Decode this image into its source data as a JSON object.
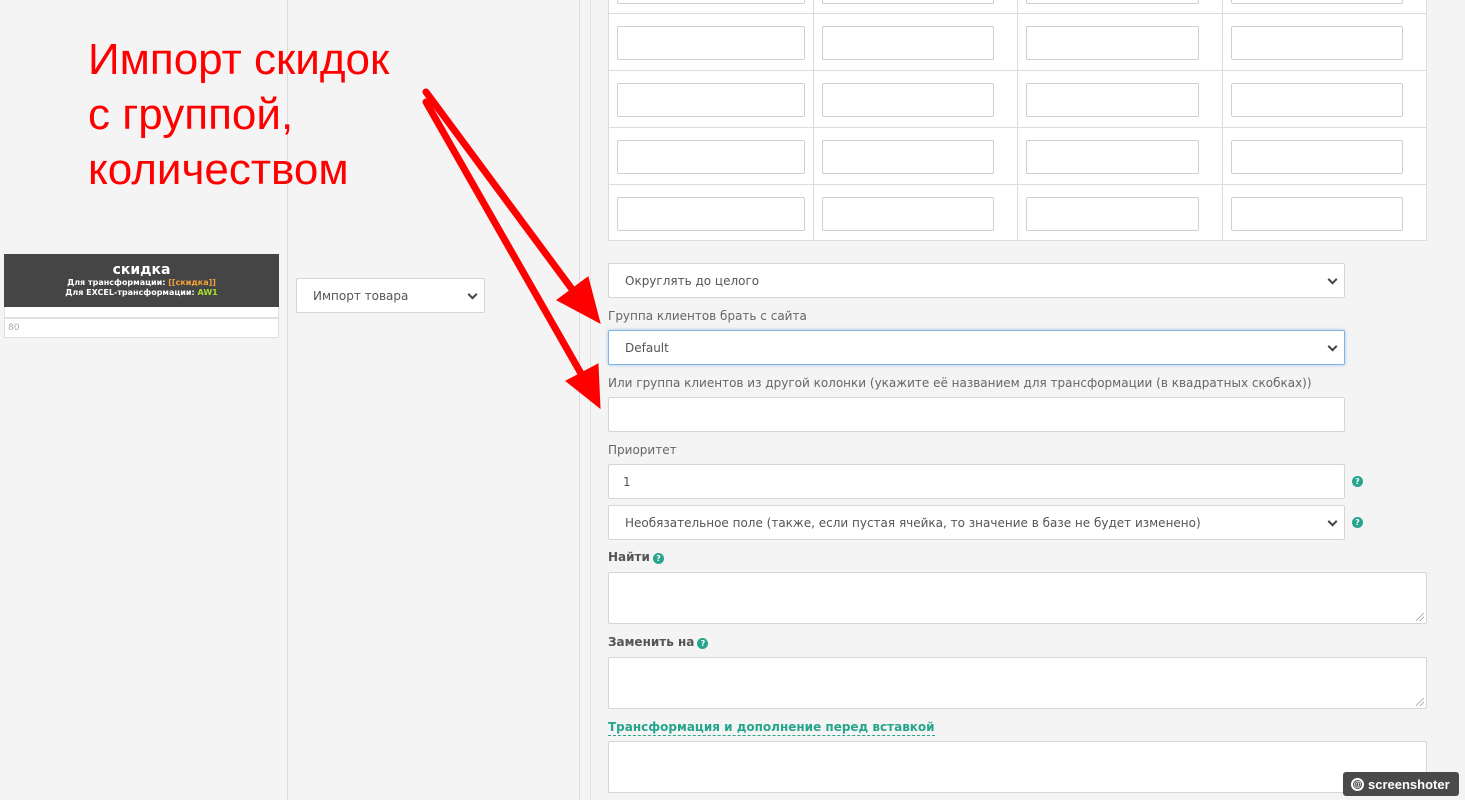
{
  "annotation": {
    "lines": [
      "Импорт скидок",
      "с группой,",
      "количеством"
    ],
    "color": "#ff0000"
  },
  "column": {
    "title": "скидка",
    "transform_label": "Для трансформации:",
    "transform_code": "[[скидка]]",
    "excel_label": "Для EXCEL-трансформации:",
    "excel_code": "AW1",
    "sample_value": "80"
  },
  "import_select": {
    "value": "Импорт товара"
  },
  "rounding_select": {
    "value": "Округлять до целого"
  },
  "client_group": {
    "label": "Группа клиентов брать с сайта",
    "value": "Default"
  },
  "client_group_column": {
    "label": "Или группа клиентов из другой колонки (укажите её названием для трансформации (в квадратных скобках))",
    "value": ""
  },
  "priority": {
    "label": "Приоритет",
    "value": "1"
  },
  "optional_select": {
    "value": "Необязательное поле (также, если пустая ячейка, то значение в базе не будет изменено)"
  },
  "find": {
    "label": "Найти",
    "value": ""
  },
  "replace": {
    "label": "Заменить на",
    "value": ""
  },
  "transform_link": {
    "label": "Трансформация и дополнение перед вставкой"
  },
  "help_glyph": "?",
  "watermark": {
    "text": "screenshoter",
    "at": "@"
  },
  "colors": {
    "accent": "#27a58c",
    "header_bg": "#454545",
    "annotation": "#ff0000"
  }
}
